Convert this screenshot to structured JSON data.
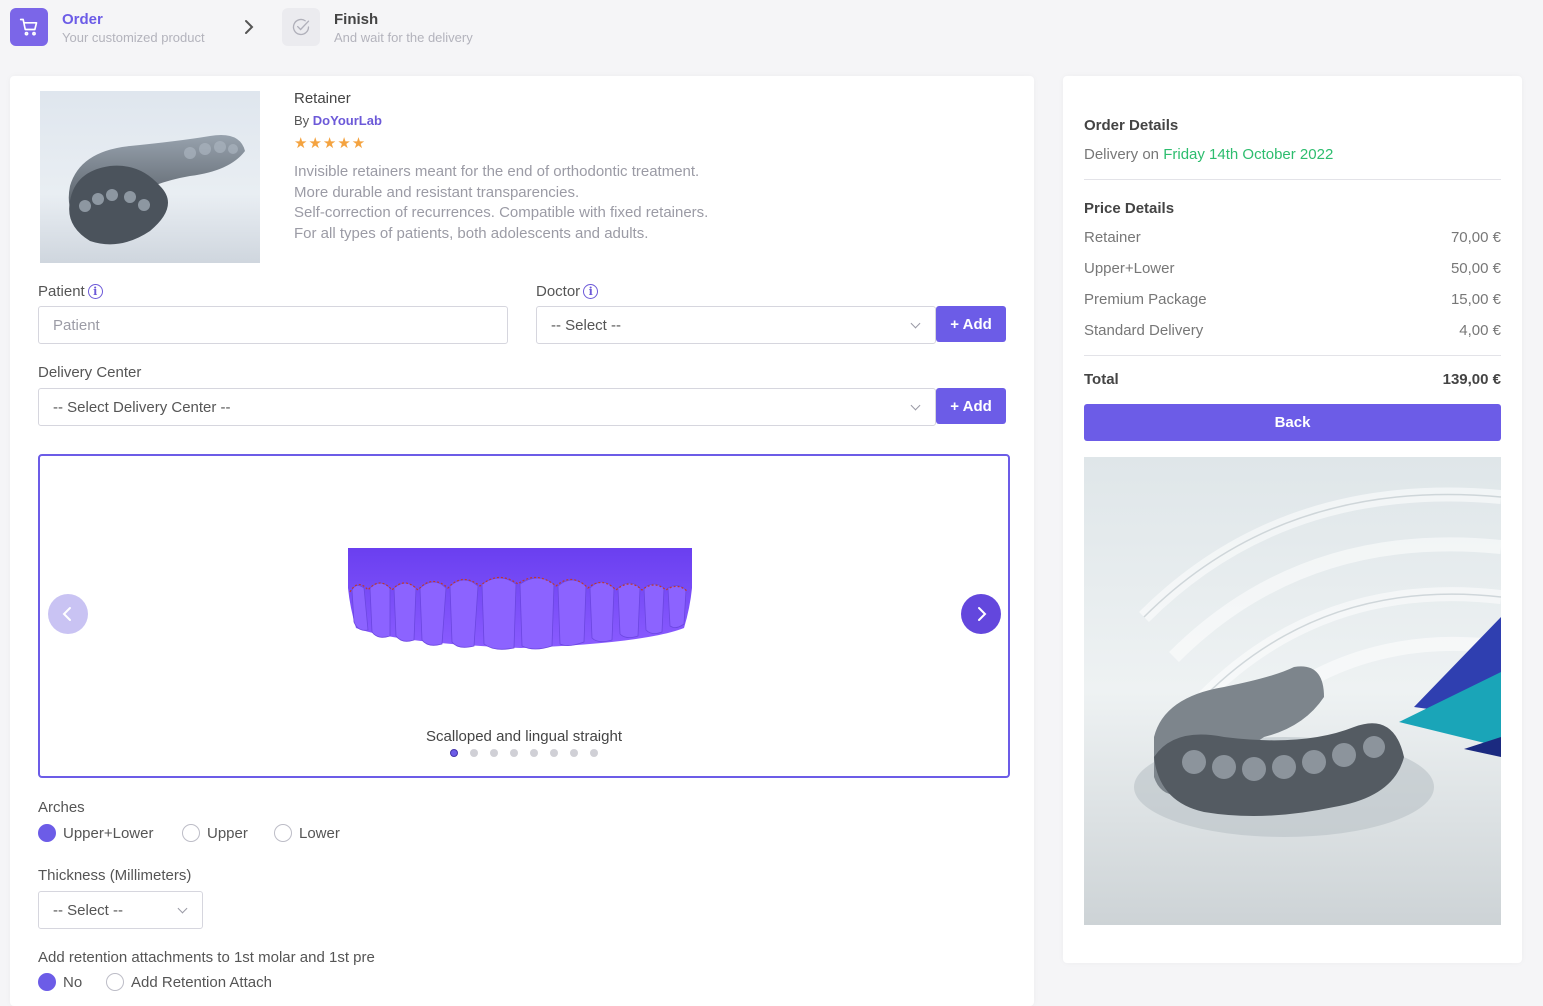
{
  "stepper": {
    "steps": [
      {
        "title": "Order",
        "subtitle": "Your customized product",
        "icon": "cart-icon",
        "active": true
      },
      {
        "title": "Finish",
        "subtitle": "And wait for the delivery",
        "icon": "check-circle-icon",
        "active": false
      }
    ]
  },
  "product": {
    "name": "Retainer",
    "by_prefix": "By",
    "brand": "DoYourLab",
    "rating": 5,
    "stars": "★★★★★",
    "description": [
      "Invisible retainers meant for the end of orthodontic treatment.",
      "More durable and resistant transparencies.",
      "Self-correction of recurrences. Compatible with fixed retainers.",
      "For all types of patients, both adolescents and adults."
    ]
  },
  "form": {
    "patient_label": "Patient",
    "patient_placeholder": "Patient",
    "doctor_label": "Doctor",
    "doctor_select": "-- Select --",
    "add_label": "+ Add",
    "delivery_center_label": "Delivery Center",
    "delivery_center_select": "-- Select Delivery Center --",
    "carousel": {
      "caption": "Scalloped and lingual straight",
      "total_slides": 8,
      "active_index": 0
    },
    "arches_label": "Arches",
    "arches_options": [
      "Upper+Lower",
      "Upper",
      "Lower"
    ],
    "arches_selected": "Upper+Lower",
    "thickness_label": "Thickness (Millimeters)",
    "thickness_select": "-- Select --",
    "retention_label": "Add retention attachments to 1st molar and 1st pre",
    "retention_options": [
      "No",
      "Add Retention Attach"
    ],
    "retention_selected": "No"
  },
  "order": {
    "title": "Order Details",
    "delivery_prefix": "Delivery on",
    "delivery_date": "Friday 14th October 2022",
    "price_title": "Price Details",
    "items": [
      {
        "label": "Retainer",
        "price": "70,00 €"
      },
      {
        "label": "Upper+Lower",
        "price": "50,00 €"
      },
      {
        "label": "Premium Package",
        "price": "15,00 €"
      },
      {
        "label": "Standard Delivery",
        "price": "4,00 €"
      }
    ],
    "total_label": "Total",
    "total_price": "139,00 €",
    "back_label": "Back"
  },
  "colors": {
    "accent": "#6c5ce7",
    "delivery_date": "#2dbd6e",
    "stars": "#f4a340"
  }
}
